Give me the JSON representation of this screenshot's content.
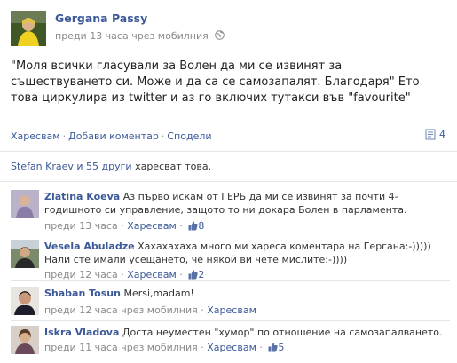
{
  "post": {
    "author": "Gergana Passy",
    "meta": "преди 13 часа чрез мобилния",
    "text": "\"Моля всички гласували за Волен да ми се извинят за съществуването си. Може и да са се самозапалят. Благодаря\" Ето това циркулира из twitter и аз го включих тутакси във \"favourite\"",
    "actions": {
      "like": "Харесвам",
      "comment": "Добави коментар",
      "share": "Сподели"
    },
    "comment_count": "4"
  },
  "likes": {
    "names": "Stefan Kraev и 55 други",
    "suffix": "харесват това."
  },
  "comments": [
    {
      "author": "Zlatina Koeva",
      "text": "Аз първо искам от ГЕРБ да ми се извинят за почти 4-годишното си управление, защото то ни докара Болен в парламента.",
      "time": "преди 13 часа",
      "like_label": "Харесвам",
      "like_count": "8"
    },
    {
      "author": "Vesela Abuladze",
      "text": "Хахахахаха много ми хареса коментара на Гергана:-))))) Нали сте имали усещането, че някой ви чете мислите:-))))",
      "time": "преди 12 часа",
      "like_label": "Харесвам",
      "like_count": "2"
    },
    {
      "author": "Shaban Tosun",
      "text": "Mersi,madam!",
      "time": "преди 12 часа чрез мобилния",
      "like_label": "Харесвам",
      "like_count": ""
    },
    {
      "author": "Iskra Vladova",
      "text": "Доста неуместен \"хумор\" по отношение на самозапалването.",
      "time": "преди 11 часа чрез мобилния",
      "like_label": "Харесвам",
      "like_count": "5"
    }
  ],
  "colors": {
    "link": "#3b5998",
    "meta": "#8a8a8a",
    "text": "#333333"
  }
}
